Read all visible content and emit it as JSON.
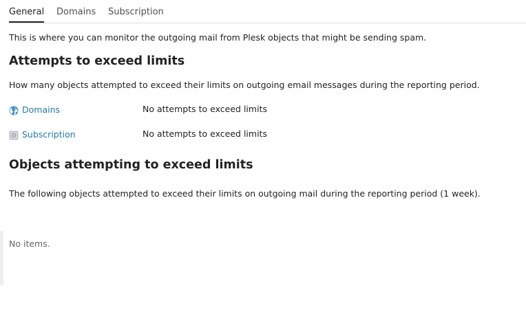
{
  "tabs": [
    {
      "label": "General",
      "active": true
    },
    {
      "label": "Domains",
      "active": false
    },
    {
      "label": "Subscription",
      "active": false
    }
  ],
  "intro": "This is where you can monitor the outgoing mail from Plesk objects that might be sending spam.",
  "attempts": {
    "title": "Attempts to exceed limits",
    "description": "How many objects attempted to exceed their limits on outgoing email messages during the reporting period.",
    "rows": [
      {
        "icon": "globe-icon",
        "label": "Domains",
        "value": "No attempts to exceed limits"
      },
      {
        "icon": "subscription-icon",
        "label": "Subscription",
        "value": "No attempts to exceed limits"
      }
    ]
  },
  "objects": {
    "title": "Objects attempting to exceed limits",
    "description": "The following objects attempted to exceed their limits on outgoing mail during the reporting period (1 week).",
    "empty_text": "No items."
  },
  "colors": {
    "link": "#1f7aaa",
    "text": "#222222",
    "muted": "#666666"
  }
}
